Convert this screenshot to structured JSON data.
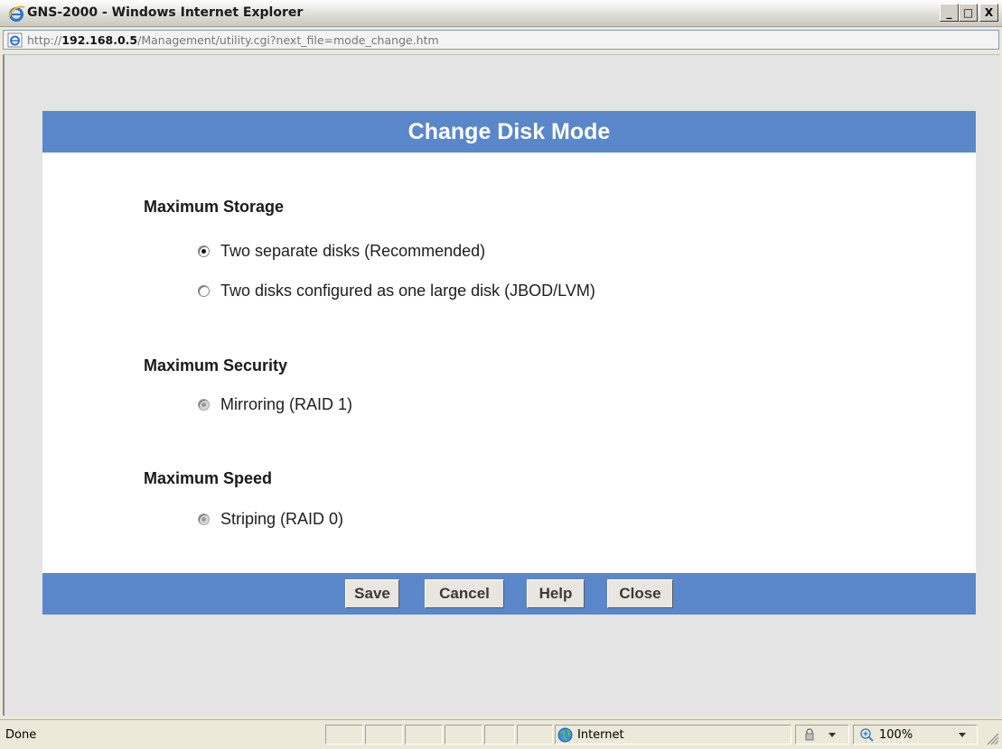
{
  "window": {
    "title": "GNS-2000 - Windows Internet Explorer",
    "controls": {
      "minimize": "_",
      "maximize": "□",
      "close": "X"
    }
  },
  "address": {
    "prefix": "http://",
    "host": "192.168.0.5",
    "path": "/Management/utility.cgi?next_file=mode_change.htm"
  },
  "dialog": {
    "title": "Change Disk Mode",
    "sections": [
      {
        "title": "Maximum Storage",
        "options": [
          {
            "label": "Two separate disks (Recommended)",
            "checked": true,
            "disabled": false
          },
          {
            "label": "Two disks configured as one large disk (JBOD/LVM)",
            "checked": false,
            "disabled": false
          }
        ]
      },
      {
        "title": "Maximum Security",
        "options": [
          {
            "label": "Mirroring (RAID 1)",
            "checked": false,
            "disabled": true
          }
        ]
      },
      {
        "title": "Maximum Speed",
        "options": [
          {
            "label": "Striping (RAID 0)",
            "checked": false,
            "disabled": true
          }
        ]
      }
    ],
    "buttons": {
      "save": "Save",
      "cancel": "Cancel",
      "help": "Help",
      "close": "Close"
    },
    "colors": {
      "bar": "#5a87c9",
      "title_text": "#ffffff"
    }
  },
  "statusbar": {
    "status": "Done",
    "zone": "Internet",
    "zoom": "100%",
    "icons": [
      "globe-icon",
      "protected-mode-icon",
      "zoom-icon",
      "resize-grip-icon"
    ]
  }
}
